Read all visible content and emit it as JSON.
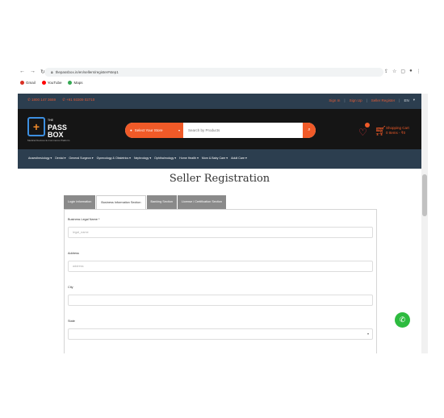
{
  "browser": {
    "url": "thepassbox.in/en/sellers/register#step1",
    "bookmarks": [
      {
        "label": "Gmail",
        "color": "#d93025"
      },
      {
        "label": "YouTube",
        "color": "#ff0000"
      },
      {
        "label": "Maps",
        "color": "#34a853"
      }
    ]
  },
  "topbar": {
    "phone1": "✆ 1800 147 3659",
    "phone2": "✆ +91 93309 02710",
    "sign_in": "Sign In",
    "sign_up": "Sign Up",
    "seller_register": "Seller Register",
    "lang": "EN",
    "lang_caret": "▾"
  },
  "header": {
    "logo_mark": "+",
    "logo_small": "THE",
    "logo_line1": "PASS",
    "logo_line2": "BOX",
    "logo_tagline": "Medical Devices E-Commerce Platform",
    "store_select": "Select Your Store",
    "search_placeholder": "Search by Products",
    "cart_title": "Shopping Cart",
    "cart_sub": "0 Items - ₹0"
  },
  "categories": [
    "Anaesthesiology ▾",
    "Dental ▾",
    "General Surgeon ▾",
    "Gynecology & Obstetrics ▾",
    "Nephrology ▾",
    "Ophthalmology ▾",
    "Home Health ▾",
    "Mom & Baby Care ▾",
    "Adult Care ▾"
  ],
  "page": {
    "title": "Seller Registration",
    "tabs": [
      "Login Information",
      "Business Information Section",
      "Banking Section",
      "License / Certification Section"
    ],
    "active_tab": 1
  },
  "form": {
    "business_name_label": "Business Legal Name *",
    "business_name_placeholder": "legal_name",
    "address_label": "Address",
    "address_placeholder": "address",
    "city_label": "City",
    "city_value": "",
    "state_label": "State",
    "state_value": ""
  },
  "colors": {
    "accent": "#f05a28",
    "dark_bar": "#2c3e4f",
    "header_bg": "#151515",
    "whatsapp": "#2dbb3f"
  }
}
